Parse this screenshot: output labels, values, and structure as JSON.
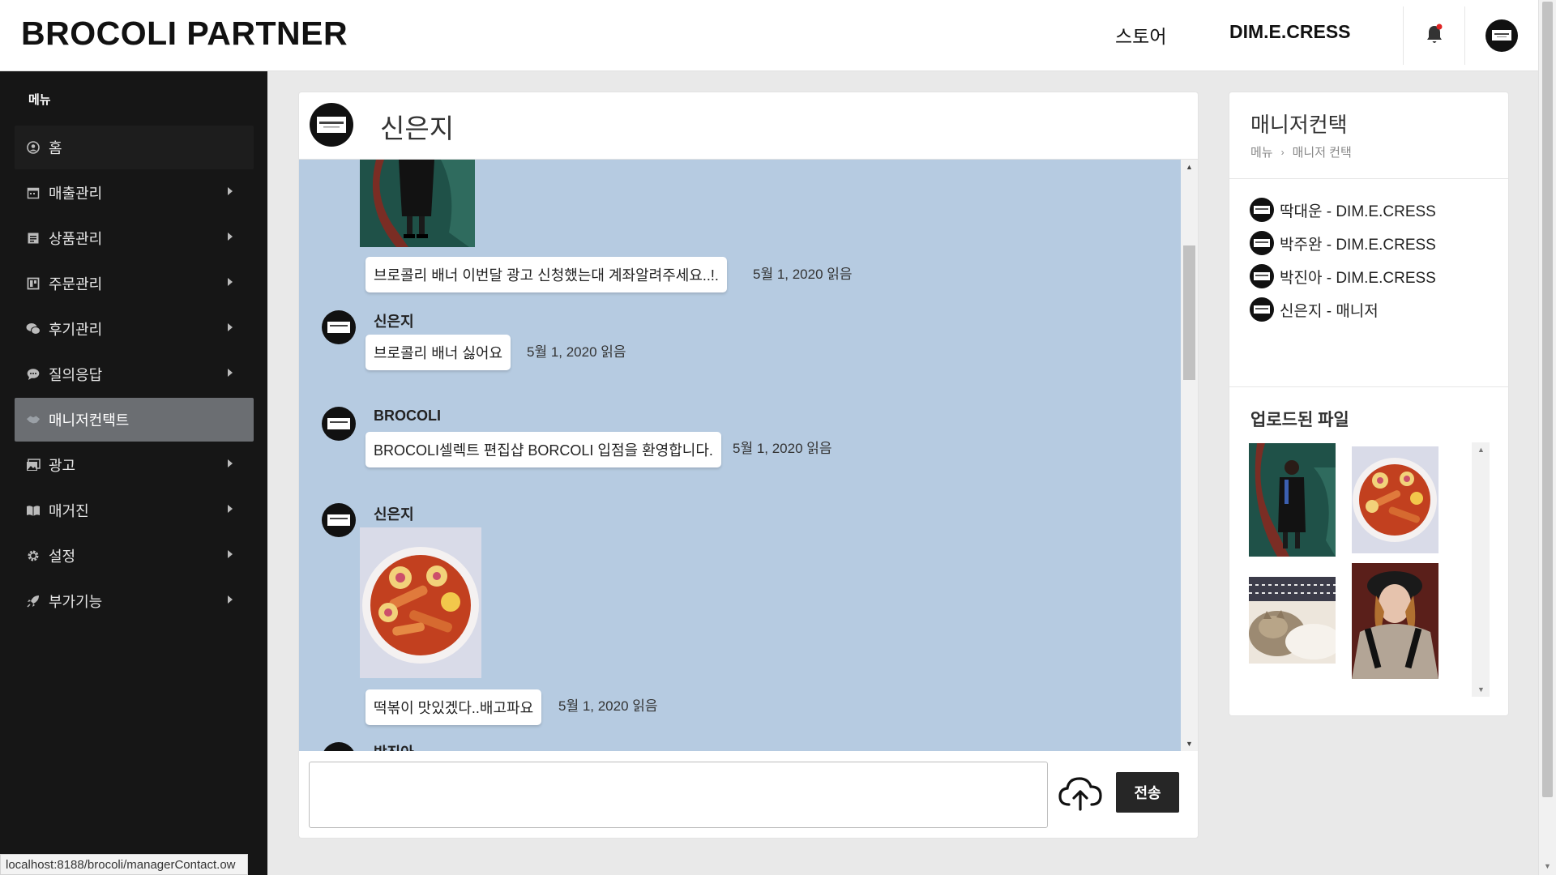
{
  "header": {
    "brand": "BROCOLI PARTNER",
    "store_link": "스토어",
    "user_link": "DIM.E.CRESS"
  },
  "sidebar": {
    "title": "메뉴",
    "items": [
      {
        "label": "홈",
        "icon": "user-circle-icon"
      },
      {
        "label": "매출관리",
        "icon": "calendar-icon"
      },
      {
        "label": "상품관리",
        "icon": "list-icon"
      },
      {
        "label": "주문관리",
        "icon": "board-icon"
      },
      {
        "label": "후기관리",
        "icon": "chat-bubbles-icon"
      },
      {
        "label": "질의응답",
        "icon": "comment-icon"
      },
      {
        "label": "매니저컨택트",
        "icon": "handshake-icon"
      },
      {
        "label": "광고",
        "icon": "image-icon"
      },
      {
        "label": "매거진",
        "icon": "book-icon"
      },
      {
        "label": "설정",
        "icon": "gear-icon"
      },
      {
        "label": "부가기능",
        "icon": "rocket-icon"
      }
    ]
  },
  "chat": {
    "title": "신은지",
    "messages": [
      {
        "text": "브로콜리 배너 이번달 광고 신청했는대 계좌알려주세요..!.",
        "date": "5월 1, 2020",
        "status": "읽음"
      },
      {
        "sender": "신은지",
        "text": "브로콜리 배너 싫어요",
        "date": "5월 1, 2020",
        "status": "읽음"
      },
      {
        "sender": "BROCOLI",
        "text": "BROCOLI셀렉트 편집샵 BORCOLI 입점을 환영합니다.",
        "date": "5월 1, 2020",
        "status": "읽음"
      },
      {
        "sender": "신은지",
        "text": "떡볶이 맛있겠다..배고파요",
        "date": "5월 1, 2020",
        "status": "읽음"
      },
      {
        "sender": "박진아"
      }
    ],
    "input_value": "",
    "send_label": "전송"
  },
  "right_panel": {
    "title": "매니저컨택",
    "breadcrumb": [
      "메뉴",
      "매니저 컨택"
    ],
    "contacts": [
      "딱대운 - DIM.E.CRESS",
      "박주완 - DIM.E.CRESS",
      "박진아 - DIM.E.CRESS",
      "신은지 - 매니저"
    ],
    "files_title": "업로드된 파일"
  },
  "status_bar": "localhost:8188/brocoli/managerContact.ow",
  "colors": {
    "chat_bg": "#b6cbe1",
    "sidebar_bg": "#161616",
    "active_item": "#6b6e72",
    "send_button": "#262626"
  }
}
